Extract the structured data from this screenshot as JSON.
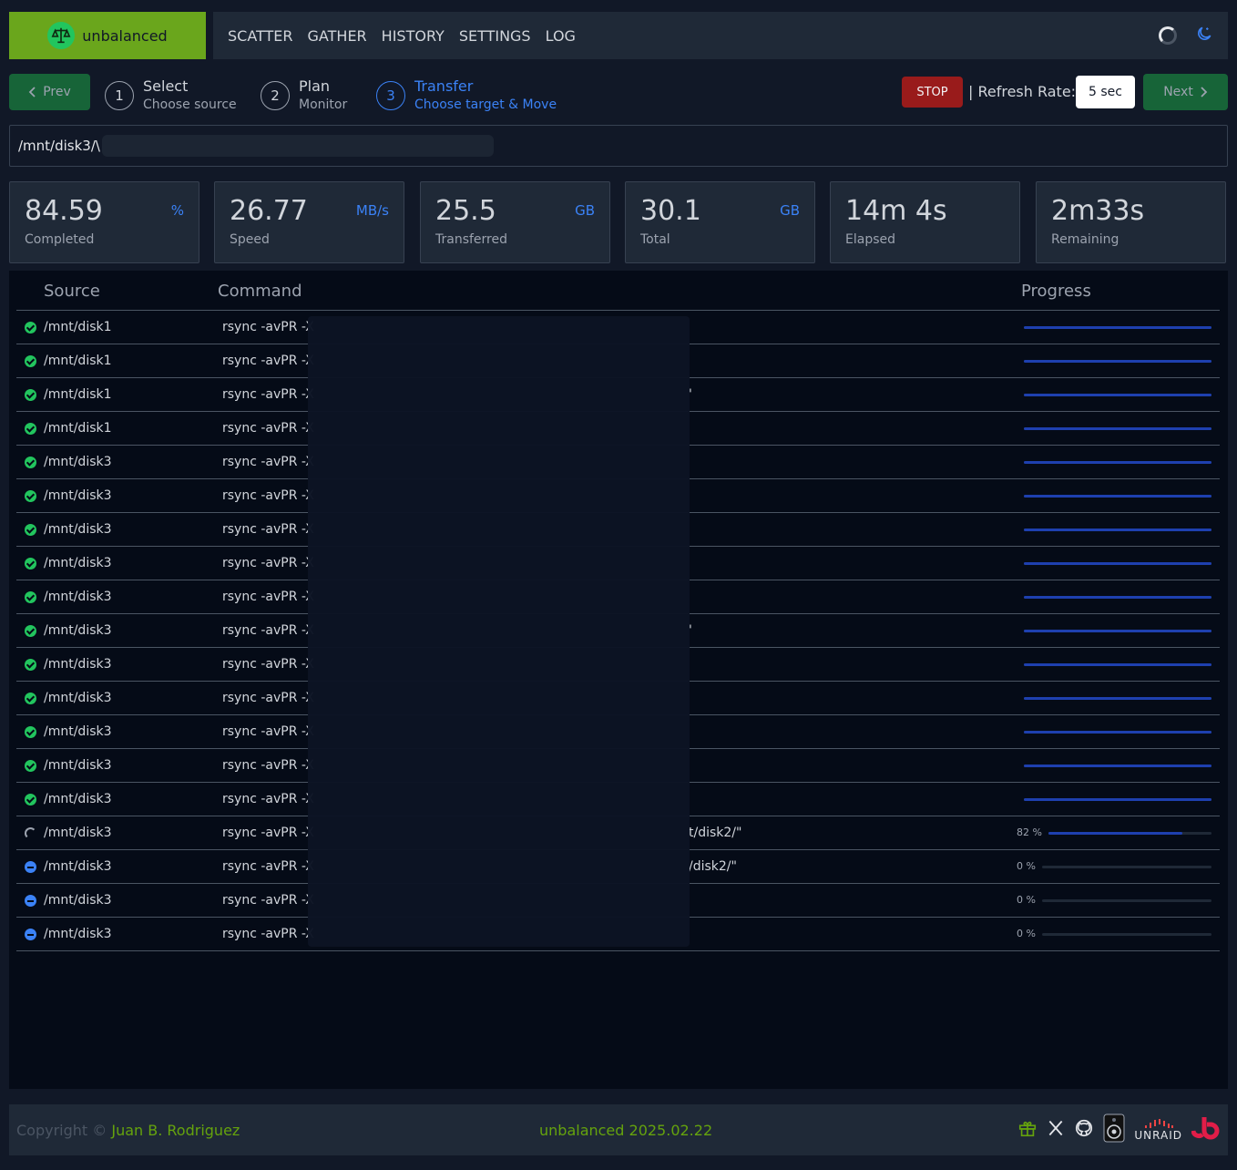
{
  "app": {
    "name": "unbalanced"
  },
  "nav": {
    "items": [
      "SCATTER",
      "GATHER",
      "HISTORY",
      "SETTINGS",
      "LOG"
    ]
  },
  "stepper": {
    "prev_label": "Prev",
    "next_label": "Next",
    "steps": [
      {
        "num": "1",
        "title": "Select",
        "sub": "Choose source"
      },
      {
        "num": "2",
        "title": "Plan",
        "sub": "Monitor"
      },
      {
        "num": "3",
        "title": "Transfer",
        "sub": "Choose target & Move"
      }
    ],
    "stop_label": "STOP",
    "refresh_label": "| Refresh Rate:",
    "refresh_value": "5 sec"
  },
  "path": {
    "value": "/mnt/disk3/\\"
  },
  "stats": [
    {
      "value": "84.59",
      "unit": "%",
      "label": "Completed"
    },
    {
      "value": "26.77",
      "unit": "MB/s",
      "label": "Speed"
    },
    {
      "value": "25.5",
      "unit": "GB",
      "label": "Transferred"
    },
    {
      "value": "30.1",
      "unit": "GB",
      "label": "Total"
    },
    {
      "value": "14m 4s",
      "unit": "",
      "label": "Elapsed"
    },
    {
      "value": "2m33s",
      "unit": "",
      "label": "Remaining"
    }
  ],
  "table": {
    "headers": {
      "source": "Source",
      "command": "Command",
      "progress": "Progress"
    },
    "rows": [
      {
        "status": "done",
        "source": "/mnt/disk1",
        "command": "rsync -avPR -X",
        "tail": "",
        "progress": 1
      },
      {
        "status": "done",
        "source": "/mnt/disk1",
        "command": "rsync -avPR -X",
        "tail": "",
        "progress": 1
      },
      {
        "status": "done",
        "source": "/mnt/disk1",
        "command": "rsync -avPR -X",
        "tail": "'",
        "progress": 1
      },
      {
        "status": "done",
        "source": "/mnt/disk1",
        "command": "rsync -avPR -X",
        "tail": "",
        "progress": 1
      },
      {
        "status": "done",
        "source": "/mnt/disk3",
        "command": "rsync -avPR -X",
        "tail": "",
        "progress": 1
      },
      {
        "status": "done",
        "source": "/mnt/disk3",
        "command": "rsync -avPR -X",
        "tail": "",
        "progress": 1
      },
      {
        "status": "done",
        "source": "/mnt/disk3",
        "command": "rsync -avPR -X",
        "tail": "",
        "progress": 1
      },
      {
        "status": "done",
        "source": "/mnt/disk3",
        "command": "rsync -avPR -X",
        "tail": "",
        "progress": 1
      },
      {
        "status": "done",
        "source": "/mnt/disk3",
        "command": "rsync -avPR -X",
        "tail": "",
        "progress": 1
      },
      {
        "status": "done",
        "source": "/mnt/disk3",
        "command": "rsync -avPR -X",
        "tail": "'",
        "progress": 1
      },
      {
        "status": "done",
        "source": "/mnt/disk3",
        "command": "rsync -avPR -X",
        "tail": "",
        "progress": 1
      },
      {
        "status": "done",
        "source": "/mnt/disk3",
        "command": "rsync -avPR -X",
        "tail": "",
        "progress": 1
      },
      {
        "status": "done",
        "source": "/mnt/disk3",
        "command": "rsync -avPR -X",
        "tail": "",
        "progress": 1
      },
      {
        "status": "done",
        "source": "/mnt/disk3",
        "command": "rsync -avPR -X",
        "tail": "",
        "progress": 1
      },
      {
        "status": "done",
        "source": "/mnt/disk3",
        "command": "rsync -avPR -X",
        "tail": "",
        "progress": 1
      },
      {
        "status": "running",
        "source": "/mnt/disk3",
        "command": "rsync -avPR -X",
        "tail": "t/disk2/\"",
        "progress": 0.82,
        "pct": "82 %"
      },
      {
        "status": "pending",
        "source": "/mnt/disk3",
        "command": "rsync -avPR -X",
        "tail": "/disk2/\"",
        "progress": 0,
        "pct": "0 %"
      },
      {
        "status": "pending",
        "source": "/mnt/disk3",
        "command": "rsync -avPR -X",
        "tail": "",
        "progress": 0,
        "pct": "0 %"
      },
      {
        "status": "pending",
        "source": "/mnt/disk3",
        "command": "rsync -avPR -X",
        "tail": "",
        "progress": 0,
        "pct": "0 %"
      }
    ]
  },
  "footer": {
    "copyright_prefix": "Copyright ©",
    "author": "Juan B. Rodriguez",
    "version": "unbalanced 2025.02.22",
    "unraid": "UNRAID"
  },
  "colors": {
    "brand": "#6aa61c",
    "accent": "#3b82f6",
    "stop": "#991b1b",
    "next": "#176438",
    "bar": "#1e40af"
  },
  "icons": [
    "scale-icon",
    "spinner-icon",
    "moon-icon",
    "chevron-left-icon",
    "chevron-right-icon",
    "check-circle-icon",
    "minus-circle-icon",
    "gift-icon",
    "x-logo-icon",
    "github-icon",
    "speaker-icon",
    "unraid-logo-icon",
    "brand-b-logo-icon"
  ]
}
